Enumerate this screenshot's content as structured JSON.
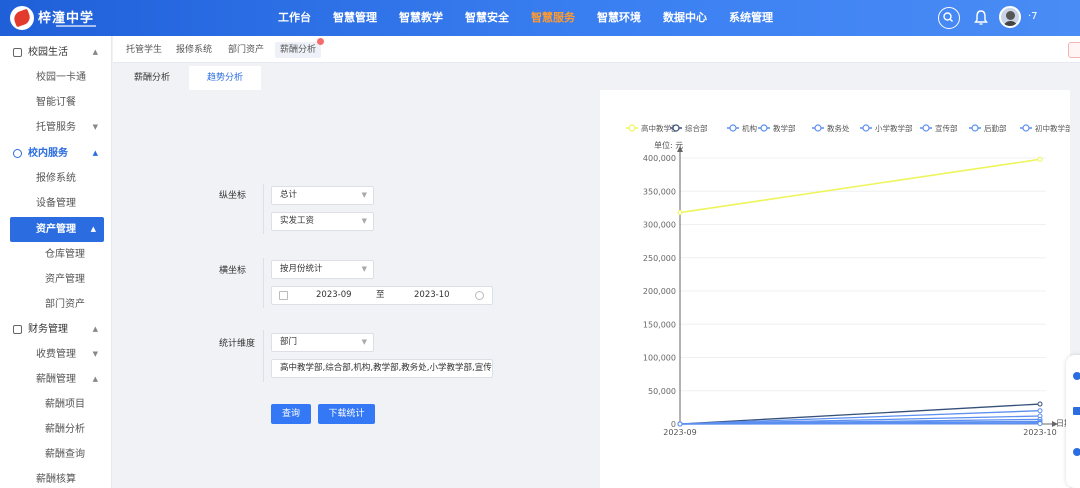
{
  "header": {
    "school_name": "梓潼中学",
    "nav": [
      "工作台",
      "智慧管理",
      "智慧教学",
      "智慧安全",
      "智慧服务",
      "智慧环境",
      "数据中心",
      "系统管理"
    ],
    "active_nav_index": 4,
    "user_suffix": "·7"
  },
  "sidebar": {
    "g1": "校园生活",
    "g1_items": [
      "校园一卡通",
      "智能订餐"
    ],
    "g1_sub": "托管服务",
    "g2": "校内服务",
    "g2_items": [
      "报修系统",
      "设备管理"
    ],
    "asset": "资产管理",
    "asset_items": [
      "仓库管理",
      "资产管理",
      "部门资产"
    ],
    "g3": "财务管理",
    "g3_sub1": "收费管理",
    "g3_sub2": "薪酬管理",
    "salary_items": [
      "薪酬项目",
      "薪酬分析",
      "薪酬查询",
      "薪酬核算"
    ]
  },
  "tabs": [
    "托管学生",
    "报修系统",
    "部门资产",
    "薪酬分析"
  ],
  "subtabs": [
    "薪酬分析",
    "趋势分析"
  ],
  "form": {
    "y_label": "纵坐标",
    "y_select1": "总计",
    "y_select2": "实发工资",
    "x_label": "横坐标",
    "x_select": "按月份统计",
    "date_start": "2023-09",
    "date_sep": "至",
    "date_end": "2023-10",
    "dim_label": "统计维度",
    "dim_select": "部门",
    "dim_values": "高中教学部,综合部,机构,教学部,教务处,小学教学部,宣传部,",
    "btn_query": "查询",
    "btn_download": "下载统计"
  },
  "chart_data": {
    "type": "line",
    "x": [
      "2023-09",
      "2023-10"
    ],
    "xlabel": "日期",
    "ylabel": "单位: 元",
    "ylim": [
      0,
      400000
    ],
    "yticks": [
      0,
      50000,
      100000,
      150000,
      200000,
      250000,
      300000,
      350000,
      400000
    ],
    "ytick_labels": [
      "0",
      "50,000",
      "100,000",
      "150,000",
      "200,000",
      "250,000",
      "300,000",
      "350,000",
      "400,000"
    ],
    "legend_position": "top",
    "series": [
      {
        "name": "高中教学部",
        "values": [
          318000,
          398000
        ],
        "color": "#eef55a"
      },
      {
        "name": "综合部",
        "values": [
          0,
          30000
        ],
        "color": "#36507a"
      },
      {
        "name": "机构",
        "values": [
          0,
          20000
        ],
        "color": "#5b8ff0"
      },
      {
        "name": "教学部",
        "values": [
          0,
          12000
        ],
        "color": "#5b8ff0"
      },
      {
        "name": "教务处",
        "values": [
          0,
          7000
        ],
        "color": "#5b8ff0"
      },
      {
        "name": "小学教学部",
        "values": [
          0,
          4000
        ],
        "color": "#5b8ff0"
      },
      {
        "name": "宣传部",
        "values": [
          0,
          2000
        ],
        "color": "#5b8ff0"
      },
      {
        "name": "后勤部",
        "values": [
          0,
          1000
        ],
        "color": "#5b8ff0"
      },
      {
        "name": "初中教学部",
        "values": [
          0,
          500
        ],
        "color": "#5b8ff0"
      }
    ]
  }
}
